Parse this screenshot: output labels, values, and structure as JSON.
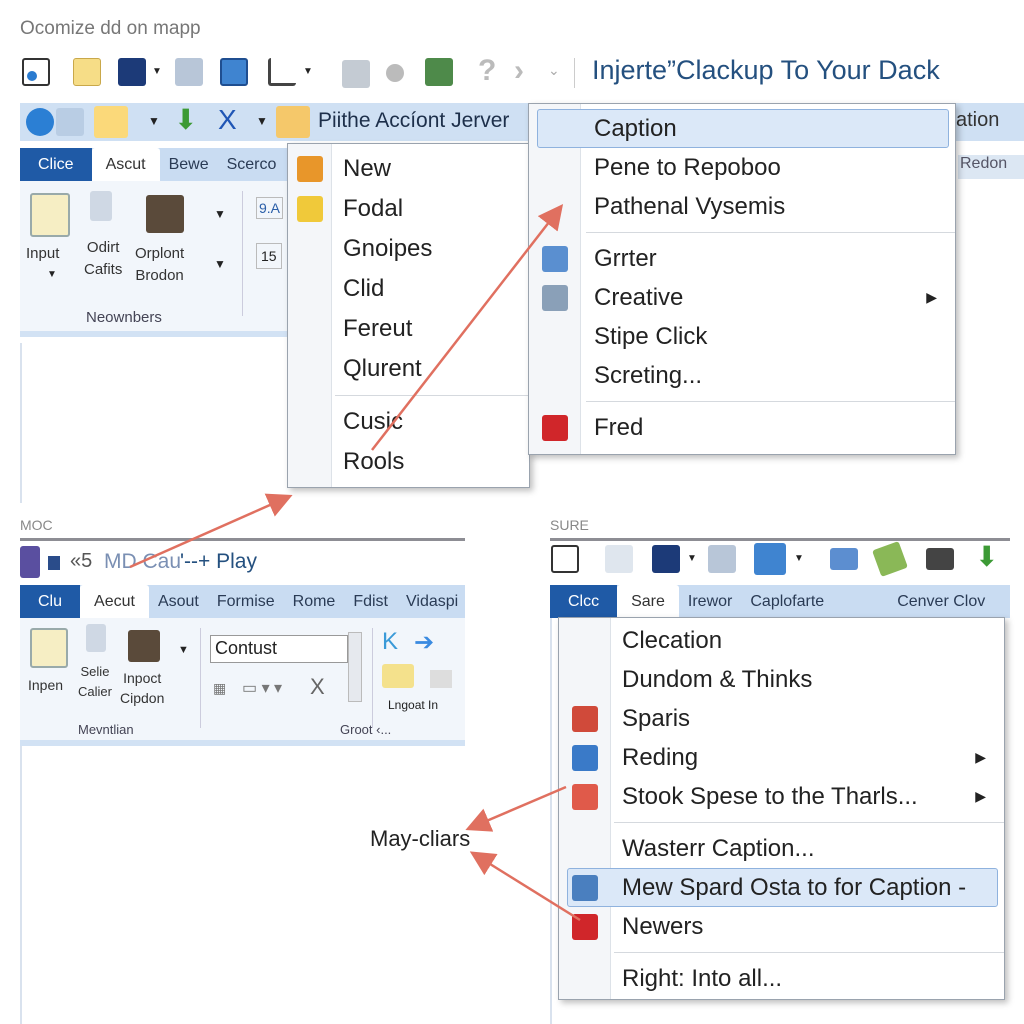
{
  "top": {
    "window_caption": "Ocomize dd on mapp",
    "heading": "Injerte”Clackup To Your Dack",
    "quick_title": "Piithe Accíont Jerver",
    "tabs": [
      "Clice",
      "Ascut",
      "Bewe",
      "Scerco"
    ],
    "ribbon": {
      "input": "Input",
      "odirt": "Odirt\nCafits",
      "orplont": "Orplont\nBrodon",
      "group": "Neownbers",
      "num": "9.A",
      "num2": "15"
    },
    "right_strip": {
      "label1": "ation",
      "label2": "Redon"
    }
  },
  "menu1": {
    "items": [
      {
        "label": "New",
        "icon": "new-icon"
      },
      {
        "label": "Fodal",
        "icon": "pin-icon"
      },
      {
        "label": "Gnoipes"
      },
      {
        "label": "Clid"
      },
      {
        "label": "Fereut"
      },
      {
        "label": "Qlurent"
      },
      {
        "type": "separator"
      },
      {
        "label": "Cusic"
      },
      {
        "label": "Rools"
      }
    ]
  },
  "menu2": {
    "items": [
      {
        "label": "Caption",
        "highlighted": true
      },
      {
        "label": "Pene to Repoboo"
      },
      {
        "label": "Pathenal Vysemis"
      },
      {
        "type": "separator"
      },
      {
        "label": "Grrter",
        "icon": "screens-icon"
      },
      {
        "label": "Creative",
        "icon": "monitor-icon",
        "submenu": true
      },
      {
        "label": "Stipe Click"
      },
      {
        "label": "Screting..."
      },
      {
        "type": "separator"
      },
      {
        "label": "Fred",
        "icon": "red-cylinder-icon"
      }
    ]
  },
  "bottom_left": {
    "section_label": "MOC",
    "title": "MD Cau",
    "title_suffix": "'--+ Play",
    "title_prefix": "«5",
    "tabs": [
      "Clu",
      "Aecut",
      "Asout",
      "Formise",
      "Rome",
      "Fdist",
      "Vidaspi"
    ],
    "ribbon": {
      "inpen": "Inpen",
      "selie": "Selie\nCalier",
      "inpoct": "Inpoct\nCipdon",
      "group1": "Mevntlian",
      "font_value": "Contust",
      "group2": "Groot ‹...",
      "lngoat": "Lngoat In"
    }
  },
  "bottom_right": {
    "section_label": "SURE",
    "tabs": [
      "Clcc",
      "Sare",
      "Irewor",
      "Caplofarte",
      "Cenver Clov"
    ]
  },
  "menu3": {
    "items": [
      {
        "label": "Clecation"
      },
      {
        "label": "Dundom & Thinks"
      },
      {
        "label": "Sparis",
        "icon": "hourglass-icon"
      },
      {
        "label": "Reding",
        "icon": "image-icon",
        "submenu": true
      },
      {
        "label": "Stook Spese to the Tharls...",
        "icon": "calendar-icon",
        "submenu": true
      },
      {
        "type": "separator"
      },
      {
        "label": "Wasterr Caption..."
      },
      {
        "label": "Mew Spard Osta to for Caption -",
        "icon": "sd-card-icon",
        "highlighted": true
      },
      {
        "label": "Newers",
        "icon": "red-lock-icon"
      },
      {
        "type": "separator"
      },
      {
        "label": "Right: Into all..."
      }
    ]
  },
  "annotation": {
    "label": "May-cliars"
  },
  "colors": {
    "accent": "#1f5aa6",
    "ribbon": "#c9dcf2",
    "heading": "#24507f",
    "arrow": "#e07060",
    "highlight": "#dbe8f8"
  }
}
